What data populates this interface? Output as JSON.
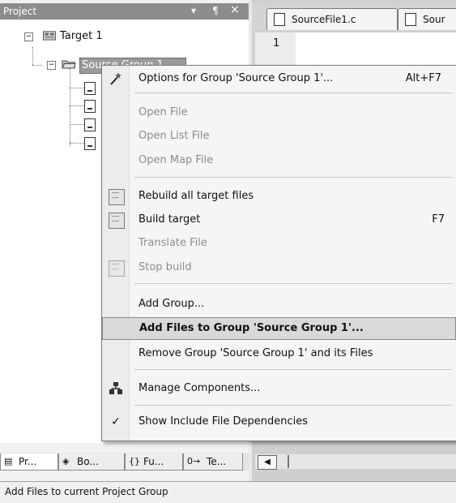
{
  "project_pane": {
    "title": "Project",
    "controls": [
      "▾",
      "¶",
      "×"
    ]
  },
  "tree": {
    "target": "Target 1",
    "group": "Source Group 1"
  },
  "editor": {
    "tabs": [
      "SourceFile1.c",
      "Sour"
    ],
    "line_numbers": [
      "1"
    ]
  },
  "context_menu": {
    "items": [
      {
        "label": "Options for Group 'Source Group 1'...",
        "shortcut": "Alt+F7",
        "enabled": true,
        "icon": "options-wand-icon"
      },
      {
        "label": "Open File",
        "enabled": false
      },
      {
        "label": "Open List File",
        "enabled": false
      },
      {
        "label": "Open Map File",
        "enabled": false
      },
      {
        "label": "Rebuild all target files",
        "enabled": true,
        "icon": "rebuild-icon"
      },
      {
        "label": "Build target",
        "shortcut": "F7",
        "enabled": true,
        "icon": "build-icon"
      },
      {
        "label": "Translate File",
        "enabled": false
      },
      {
        "label": "Stop build",
        "enabled": false,
        "icon": "stop-build-icon"
      },
      {
        "label": "Add Group...",
        "enabled": true
      },
      {
        "label": "Add Files to Group 'Source Group 1'...",
        "enabled": true,
        "highlighted": true
      },
      {
        "label": "Remove Group 'Source Group 1' and its Files",
        "enabled": true
      },
      {
        "label": "Manage Components...",
        "enabled": true,
        "icon": "components-icon"
      },
      {
        "label": "Show Include File Dependencies",
        "enabled": true,
        "checked": true,
        "icon": "check-icon"
      }
    ]
  },
  "pane_tabs": [
    {
      "label": "Pr...",
      "icon": "project-tab-icon",
      "active": true
    },
    {
      "label": "Bo...",
      "icon": "books-tab-icon"
    },
    {
      "label": "Fu...",
      "icon": "functions-tab-icon",
      "glyph": "{}"
    },
    {
      "label": "Te...",
      "icon": "templates-tab-icon",
      "glyph": "0→"
    }
  ],
  "status_bar": {
    "text": "Add Files to current Project Group"
  }
}
